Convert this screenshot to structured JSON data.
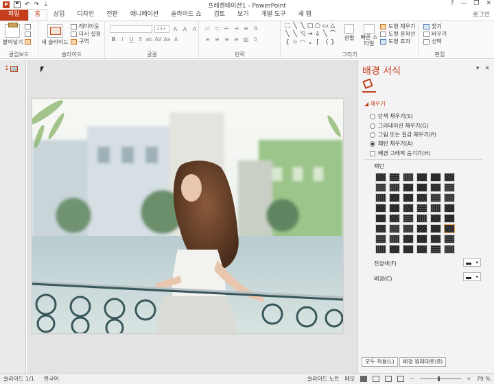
{
  "title_bar": {
    "title": "프레젠테이션1 - PowerPoint",
    "logo_text": "P",
    "undo_glyph": "↶",
    "redo_glyph": "↷",
    "customize_glyph": "⇣",
    "help": "?",
    "minimize": "—",
    "restore": "❐",
    "close": "✕"
  },
  "tabs": [
    "파일",
    "홈",
    "삽입",
    "디자인",
    "전환",
    "애니메이션",
    "슬라이드 쇼",
    "검토",
    "보기",
    "개발 도구",
    "새 탭"
  ],
  "active_tab": "홈",
  "signin": "로그인",
  "ribbon": {
    "clipboard": {
      "paste": "붙여넣기",
      "label": "클립보드"
    },
    "slides": {
      "new_slide": "새 슬라이드",
      "layout": "레이아웃",
      "reset": "다시 설정",
      "section": "구역",
      "label": "슬라이드"
    },
    "font": {
      "size": "24+",
      "label": "글꼴"
    },
    "paragraph": {
      "label": "단락"
    },
    "drawing": {
      "arrange": "정렬",
      "quick_styles": "빠른 스타일",
      "fill": "도형 채우기",
      "outline": "도형 윤곽선",
      "effects": "도형 효과",
      "label": "그리기"
    },
    "editing": {
      "find": "찾기",
      "replace": "바꾸기",
      "select": "선택",
      "label": "편집"
    }
  },
  "shape_glyphs": [
    "⬚",
    "╲",
    "╲",
    "□",
    "○",
    "▭",
    "△",
    "╲",
    "╲",
    "◹",
    "⇒",
    "⇩",
    "╲",
    "⌒",
    "{",
    "☆",
    "◠",
    "⌄",
    "⌈",
    "〈",
    "}"
  ],
  "slide_panel": {
    "number": "1"
  },
  "format_pane": {
    "title": "배경 서식",
    "dropdown_glyph": "▾",
    "close_glyph": "✕",
    "section": "◢ 채우기",
    "options": [
      "단색 채우기(S)",
      "그라데이션 채우기(G)",
      "그림 또는 질감 채우기(P)",
      "패턴 채우기(A)"
    ],
    "selected_option": 3,
    "hide_graphics": "배경 그래픽 숨기기(H)",
    "pattern_label": "패턴",
    "foreground_label": "전경색(F)",
    "background_label": "배경(C)",
    "apply_all": "모두 적용(L)",
    "reset_background": "배경 원래대로(B)",
    "color_button_arrow": "▾"
  },
  "status_bar": {
    "slide_info": "슬라이드 1/1",
    "language": "한국어",
    "notes": "슬라이드 노트",
    "comments": "메모",
    "zoom": "79 %",
    "zoom_minus": "−",
    "zoom_plus": "+"
  },
  "colors": {
    "accent": "#c43e1c",
    "pane_bg": "#f3f3f3",
    "canvas_bg": "#e3e3e3"
  }
}
